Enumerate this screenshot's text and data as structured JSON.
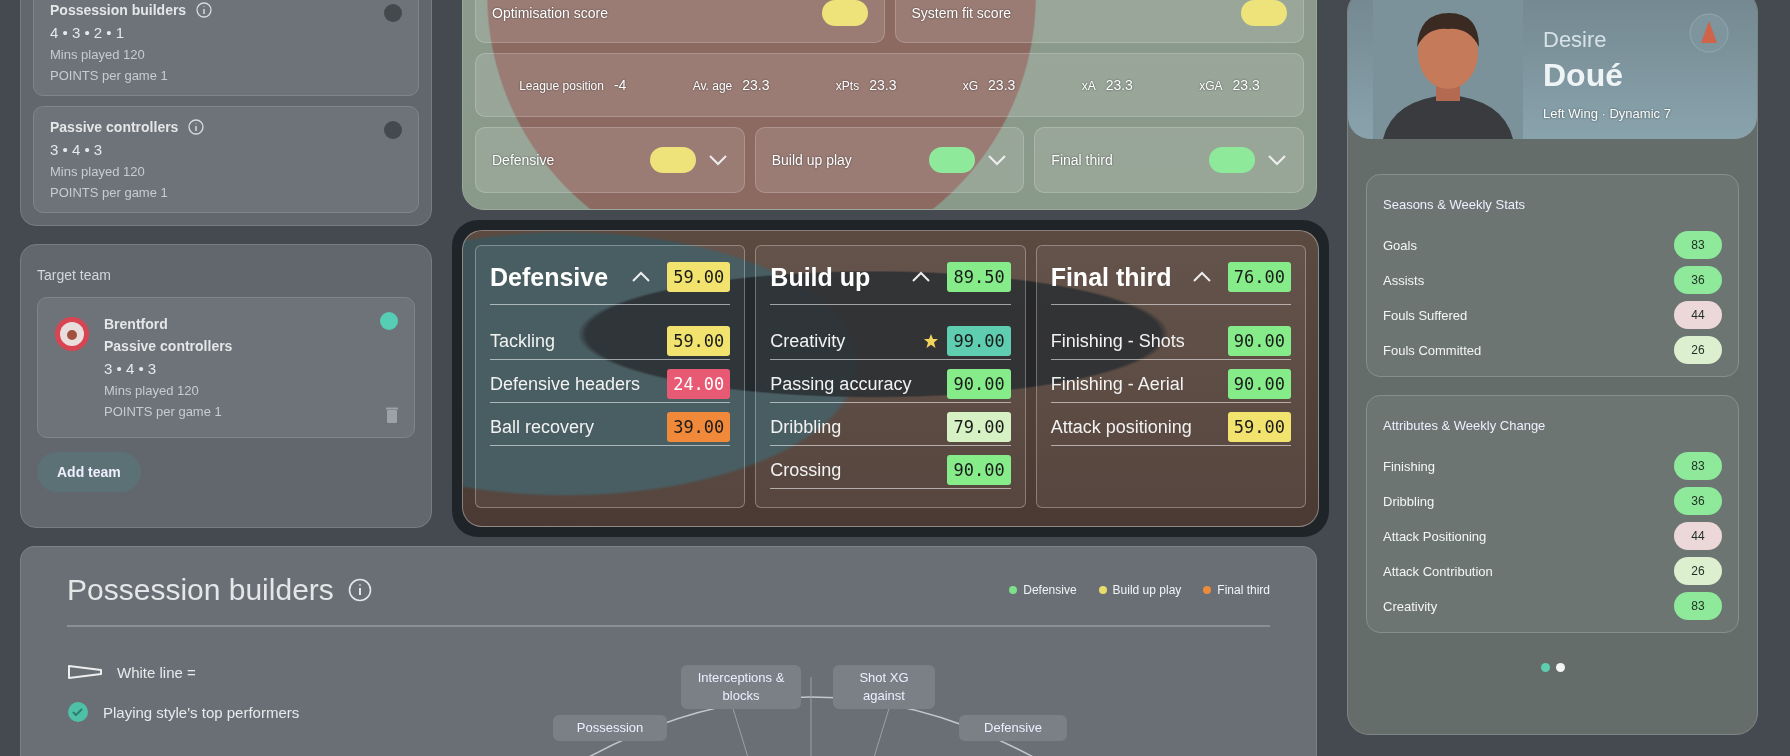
{
  "styles": [
    {
      "name": "Possession builders",
      "formation": "4 • 3 • 2 • 1",
      "mins": "Mins played 120",
      "points": "POINTS per game 1",
      "selected": false
    },
    {
      "name": "Passive controllers",
      "formation": "3 • 4 • 3",
      "mins": "Mins played 120",
      "points": "POINTS per game 1",
      "selected": false
    }
  ],
  "target": {
    "title": "Target team",
    "club": "Brentford",
    "style": "Passive controllers",
    "formation": "3 • 4 • 3",
    "mins": "Mins played 120",
    "points": "POINTS per game 1",
    "selected": true,
    "add_button": "Add team"
  },
  "summary": {
    "scores": [
      {
        "label": "Optimisation score",
        "color": "#eee27a"
      },
      {
        "label": "System fit score",
        "color": "#eee27a"
      }
    ],
    "stats": [
      {
        "label": "League position",
        "value": "-4"
      },
      {
        "label": "Av. age",
        "value": "23.3"
      },
      {
        "label": "xPts",
        "value": "23.3"
      },
      {
        "label": "xG",
        "value": "23.3"
      },
      {
        "label": "xA",
        "value": "23.3"
      },
      {
        "label": "xGA",
        "value": "23.3"
      }
    ],
    "categories": [
      {
        "label": "Defensive",
        "color": "#eee27a",
        "expanded": false
      },
      {
        "label": "Build up play",
        "color": "#8ee99a",
        "expanded": false
      },
      {
        "label": "Final third",
        "color": "#8ee99a",
        "expanded": false
      }
    ]
  },
  "focus": [
    {
      "title": "Defensive",
      "score": "59.00",
      "color": "#f2e36e",
      "expanded": true,
      "rows": [
        {
          "label": "Tackling",
          "value": "59.00",
          "color": "#f2e36e",
          "favorite": false
        },
        {
          "label": "Defensive headers",
          "value": "24.00",
          "color": "#e85a73",
          "favorite": false
        },
        {
          "label": "Ball recovery",
          "value": "39.00",
          "color": "#f08a3a",
          "favorite": false
        }
      ]
    },
    {
      "title": "Build up",
      "score": "89.50",
      "color": "#86ec8a",
      "expanded": true,
      "rows": [
        {
          "label": "Creativity",
          "value": "99.00",
          "color": "#5ecdb0",
          "favorite": true
        },
        {
          "label": "Passing accuracy",
          "value": "90.00",
          "color": "#86ec8a",
          "favorite": false
        },
        {
          "label": "Dribbling",
          "value": "79.00",
          "color": "#d6f2c4",
          "favorite": false
        },
        {
          "label": "Crossing",
          "value": "90.00",
          "color": "#86ec8a",
          "favorite": false
        }
      ]
    },
    {
      "title": "Final third",
      "score": "76.00",
      "color": "#86ec8a",
      "expanded": true,
      "rows": [
        {
          "label": "Finishing - Shots",
          "value": "90.00",
          "color": "#86ec8a",
          "favorite": false
        },
        {
          "label": "Finishing - Aerial",
          "value": "90.00",
          "color": "#86ec8a",
          "favorite": false
        },
        {
          "label": "Attack positioning",
          "value": "59.00",
          "color": "#f2e36e",
          "favorite": false
        }
      ]
    }
  ],
  "player": {
    "first_name": "Desire",
    "last_name": "Doué",
    "meta": "Left Wing · Dynamic 7"
  },
  "cards": [
    {
      "title": "Seasons & Weekly Stats",
      "rows": [
        {
          "label": "Goals",
          "value": "83",
          "color": "#8ee99a"
        },
        {
          "label": "Assists",
          "value": "36",
          "color": "#8ee99a"
        },
        {
          "label": "Fouls Suffered",
          "value": "44",
          "color": "#ecd8d8"
        },
        {
          "label": "Fouls Committed",
          "value": "26",
          "color": "#dcefcf"
        }
      ]
    },
    {
      "title": "Attributes & Weekly Change",
      "rows": [
        {
          "label": "Finishing",
          "value": "83",
          "color": "#8ee99a"
        },
        {
          "label": "Dribbling",
          "value": "36",
          "color": "#8ee99a"
        },
        {
          "label": "Attack Positioning",
          "value": "44",
          "color": "#ecd8d8"
        },
        {
          "label": "Attack Contribution",
          "value": "26",
          "color": "#dcefcf"
        },
        {
          "label": "Creativity",
          "value": "83",
          "color": "#8ee99a"
        }
      ]
    }
  ],
  "pager": [
    {
      "selected": true
    },
    {
      "selected": false
    }
  ],
  "bottom": {
    "title": "Possession builders",
    "legend": [
      {
        "label": "Defensive",
        "color": "#7ee08a"
      },
      {
        "label": "Build up play",
        "color": "#e8dc6a"
      },
      {
        "label": "Final third",
        "color": "#ee8a3c"
      }
    ],
    "key_line": "White line =",
    "key_top": "Playing style's top performers",
    "radar_labels": [
      "Interceptions & blocks",
      "Shot XG against",
      "Possession",
      "Defensive"
    ]
  }
}
